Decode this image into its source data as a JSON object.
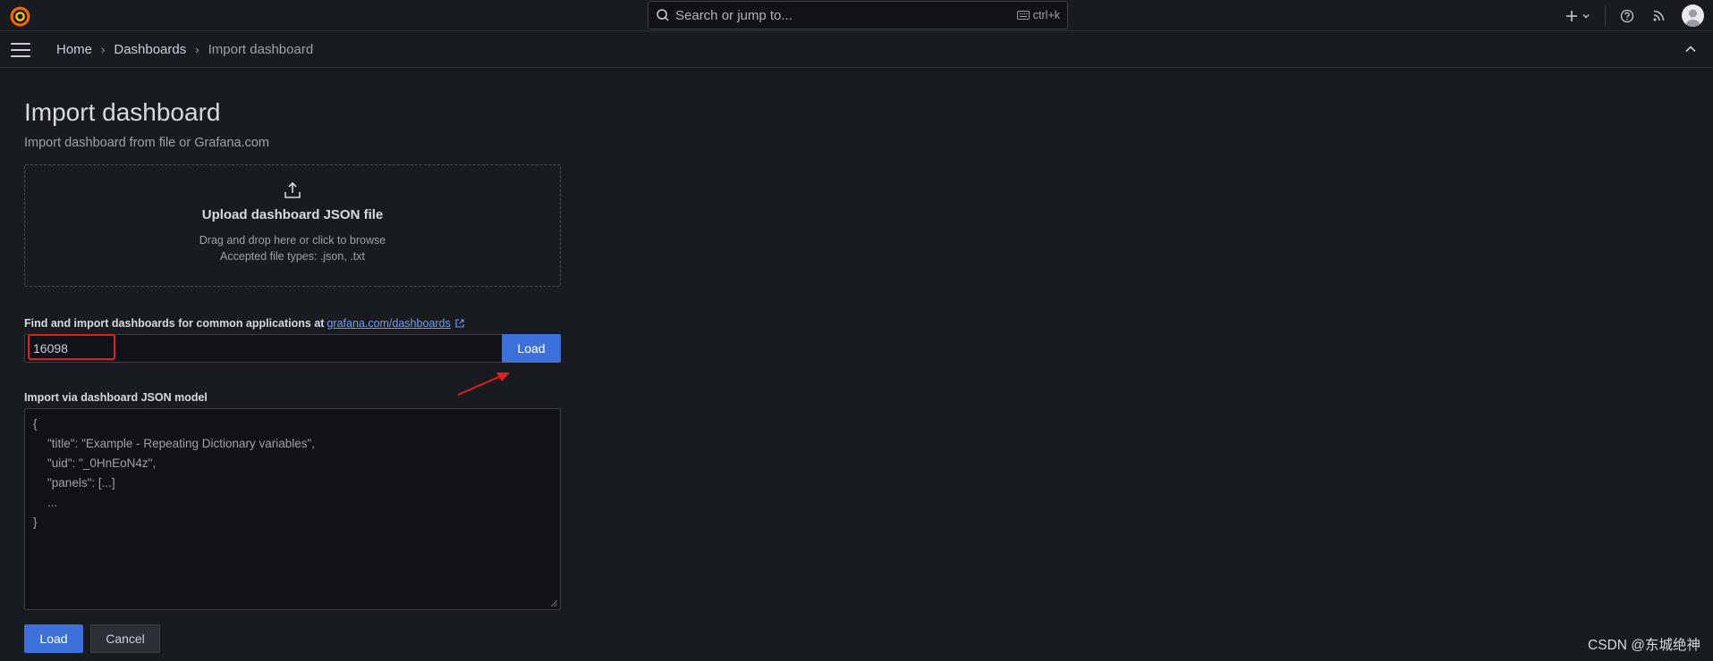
{
  "search": {
    "placeholder": "Search or jump to...",
    "shortcut": "ctrl+k"
  },
  "breadcrumb": {
    "items": [
      "Home",
      "Dashboards",
      "Import dashboard"
    ]
  },
  "page": {
    "title": "Import dashboard",
    "subtitle": "Import dashboard from file or Grafana.com"
  },
  "upload": {
    "title": "Upload dashboard JSON file",
    "hint": "Drag and drop here or click to browse",
    "accepted": "Accepted file types: .json, .txt"
  },
  "grafana_com": {
    "label": "Find and import dashboards for common applications at",
    "link_text": "grafana.com/dashboards",
    "input_value": "16098",
    "load_label": "Load"
  },
  "json_model": {
    "label": "Import via dashboard JSON model",
    "lines": [
      "{",
      "\"title\": \"Example - Repeating Dictionary variables\",",
      "\"uid\": \"_0HnEoN4z\",",
      "\"panels\": [...]",
      "...",
      "}"
    ]
  },
  "actions": {
    "load_label": "Load",
    "cancel_label": "Cancel"
  },
  "watermark": "CSDN @东城绝神",
  "colors": {
    "primary": "#3d71d9",
    "background": "#181b1f",
    "highlight": "#e02020"
  },
  "icons": [
    "grafana-logo-icon",
    "search-icon",
    "keyboard-icon",
    "plus-icon",
    "chevron-down-icon",
    "help-icon",
    "rss-icon",
    "avatar",
    "menu-icon",
    "chevron-up-icon",
    "upload-icon",
    "external-link-icon"
  ]
}
